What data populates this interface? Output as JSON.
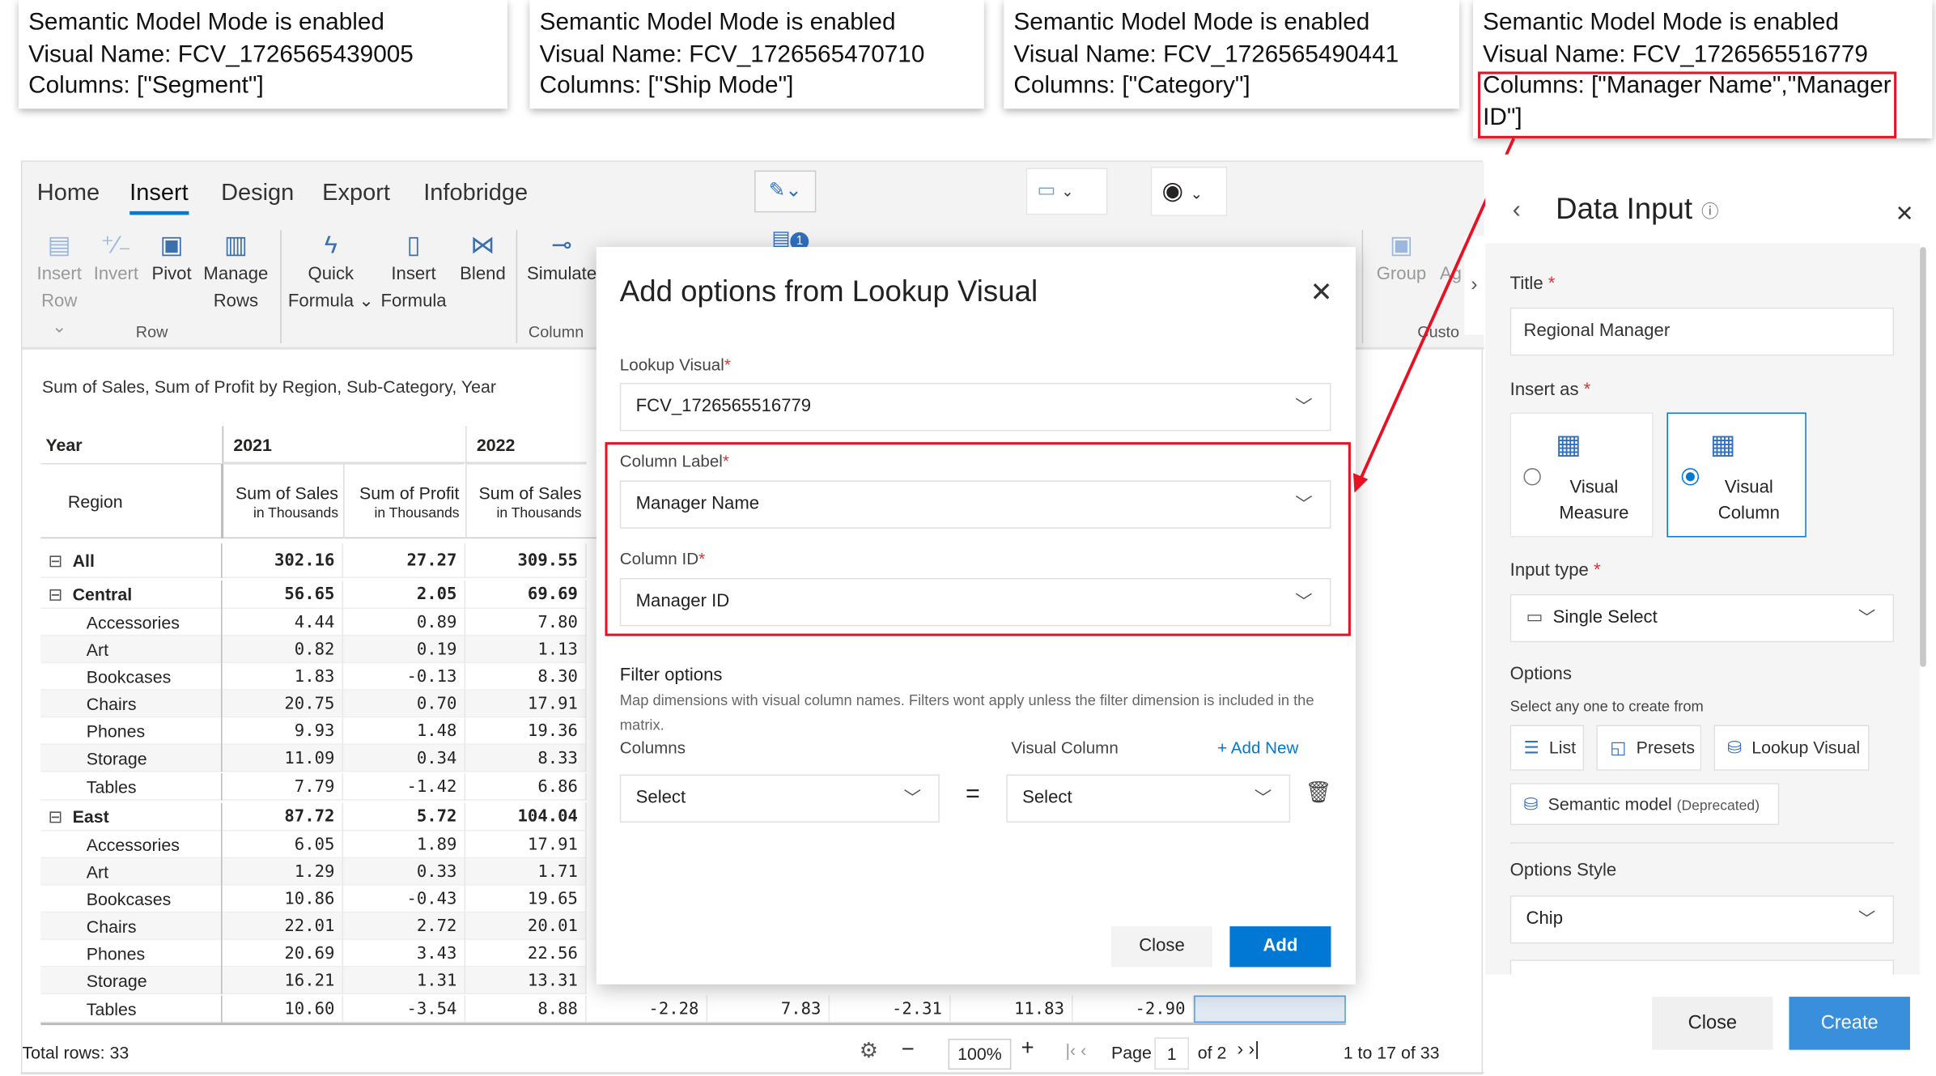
{
  "tooltips": [
    {
      "line1": "Semantic Model Mode is enabled",
      "line2": "Visual Name: FCV_1726565439005",
      "line3": "Columns: [\"Segment\"]"
    },
    {
      "line1": "Semantic Model Mode is enabled",
      "line2": "Visual Name: FCV_1726565470710",
      "line3": "Columns: [\"Ship Mode\"]"
    },
    {
      "line1": "Semantic Model Mode is enabled",
      "line2": "Visual Name: FCV_1726565490441",
      "line3": "Columns: [\"Category\"]"
    },
    {
      "line1": "Semantic Model Mode is enabled",
      "line2": "Visual Name: FCV_1726565516779",
      "line3": "Columns: [\"Manager Name\",\"Manager",
      "line4": "ID\"]"
    }
  ],
  "colors": {
    "accent": "#0078d4",
    "highlight": "#e81123",
    "panel_bg": "#f5f5f5"
  },
  "ribbon": {
    "tabs": [
      "Home",
      "Insert",
      "Design",
      "Export",
      "Infobridge"
    ],
    "active_tab": "Insert",
    "buttons": [
      {
        "l1": "Insert",
        "l2": "Row ⌄",
        "icon": "insert-row-icon"
      },
      {
        "l1": "Invert",
        "l2": "",
        "icon": "invert-icon"
      },
      {
        "l1": "Pivot",
        "l2": "",
        "icon": "pivot-icon"
      },
      {
        "l1": "Manage",
        "l2": "Rows",
        "icon": "manage-rows-icon"
      },
      {
        "l1": "Quick",
        "l2": "Formula ⌄",
        "icon": "quick-formula-icon"
      },
      {
        "l1": "Insert",
        "l2": "Formula",
        "icon": "insert-formula-icon"
      },
      {
        "l1": "Blend",
        "l2": "",
        "icon": "blend-icon"
      },
      {
        "l1": "Simulate",
        "l2": "",
        "icon": "simulate-icon"
      },
      {
        "l1": "Group",
        "l2": "",
        "icon": "group-icon"
      },
      {
        "l1": "Ag",
        "l2": "",
        "icon": "aggregate-icon"
      }
    ],
    "groups": [
      "Row",
      "Column",
      "Custo"
    ],
    "badge": "1"
  },
  "report": {
    "subtitle": "Sum of Sales, Sum of Profit by Region, Sub-Category, Year",
    "year_label": "Year",
    "years": [
      "2021",
      "2022"
    ],
    "region_label": "Region",
    "measures": [
      {
        "name": "Sum of Sales",
        "unit": "in Thousands"
      },
      {
        "name": "Sum of Profit",
        "unit": "in Thousands"
      },
      {
        "name": "Sum of Sales",
        "unit": "in Thousands"
      }
    ],
    "rows": [
      {
        "label": "All",
        "level": 0,
        "expander": "⊟",
        "values": [
          "302.16",
          "27.27",
          "309.55"
        ]
      },
      {
        "label": "Central",
        "level": 0,
        "expander": "⊟",
        "values": [
          "56.65",
          "2.05",
          "69.69"
        ]
      },
      {
        "label": "Accessories",
        "level": 1,
        "values": [
          "4.44",
          "0.89",
          "7.80"
        ]
      },
      {
        "label": "Art",
        "level": 1,
        "values": [
          "0.82",
          "0.19",
          "1.13"
        ]
      },
      {
        "label": "Bookcases",
        "level": 1,
        "values": [
          "1.83",
          "-0.13",
          "8.30"
        ]
      },
      {
        "label": "Chairs",
        "level": 1,
        "values": [
          "20.75",
          "0.70",
          "17.91"
        ]
      },
      {
        "label": "Phones",
        "level": 1,
        "values": [
          "9.93",
          "1.48",
          "19.36"
        ]
      },
      {
        "label": "Storage",
        "level": 1,
        "values": [
          "11.09",
          "0.34",
          "8.33"
        ]
      },
      {
        "label": "Tables",
        "level": 1,
        "values": [
          "7.79",
          "-1.42",
          "6.86"
        ]
      },
      {
        "label": "East",
        "level": 0,
        "expander": "⊟",
        "values": [
          "87.72",
          "5.72",
          "104.04"
        ]
      },
      {
        "label": "Accessories",
        "level": 1,
        "values": [
          "6.05",
          "1.89",
          "17.91"
        ]
      },
      {
        "label": "Art",
        "level": 1,
        "values": [
          "1.29",
          "0.33",
          "1.71"
        ]
      },
      {
        "label": "Bookcases",
        "level": 1,
        "values": [
          "10.86",
          "-0.43",
          "19.65"
        ]
      },
      {
        "label": "Chairs",
        "level": 1,
        "values": [
          "22.01",
          "2.72",
          "20.01"
        ]
      },
      {
        "label": "Phones",
        "level": 1,
        "values": [
          "20.69",
          "3.43",
          "22.56"
        ]
      },
      {
        "label": "Storage",
        "level": 1,
        "values": [
          "16.21",
          "1.31",
          "13.31"
        ]
      },
      {
        "label": "Tables",
        "level": 1,
        "values": [
          "10.60",
          "-3.54",
          "8.88",
          "-2.28",
          "7.83",
          "-2.31",
          "11.83",
          "-2.90",
          ""
        ]
      }
    ]
  },
  "footer": {
    "total_rows": "Total rows: 33",
    "zoom": "100%",
    "page_label": "Page",
    "page": "1",
    "of_pages": "of 2",
    "range": "1 to 17 of 33"
  },
  "dialog": {
    "title": "Add options from Lookup Visual",
    "lookup_label": "Lookup Visual",
    "lookup_value": "FCV_1726565516779",
    "column_label_label": "Column Label",
    "column_label_value": "Manager Name",
    "column_id_label": "Column ID",
    "column_id_value": "Manager ID",
    "filter_title": "Filter options",
    "filter_desc": "Map dimensions with visual column names. Filters wont apply unless the filter dimension is included in the matrix.",
    "columns_label": "Columns",
    "visual_column_label": "Visual Column",
    "add_new": "+ Add New",
    "columns_select": "Select",
    "visual_select": "Select",
    "equals": "=",
    "close": "Close",
    "add": "Add"
  },
  "panel": {
    "title": "Data Input",
    "title_label": "Title",
    "title_value": "Regional Manager",
    "insert_as_label": "Insert as",
    "insert_options": [
      {
        "l1": "Visual",
        "l2": "Measure",
        "selected": false
      },
      {
        "l1": "Visual",
        "l2": "Column",
        "selected": true
      }
    ],
    "input_type_label": "Input type",
    "input_type_value": "Single Select",
    "options_label": "Options",
    "options_hint": "Select any one to create from",
    "option_sources": [
      "List",
      "Presets",
      "Lookup Visual"
    ],
    "semantic": "Semantic model",
    "deprecated": "(Deprecated)",
    "options_style_label": "Options Style",
    "options_style_value": "Chip",
    "close": "Close",
    "create": "Create"
  }
}
